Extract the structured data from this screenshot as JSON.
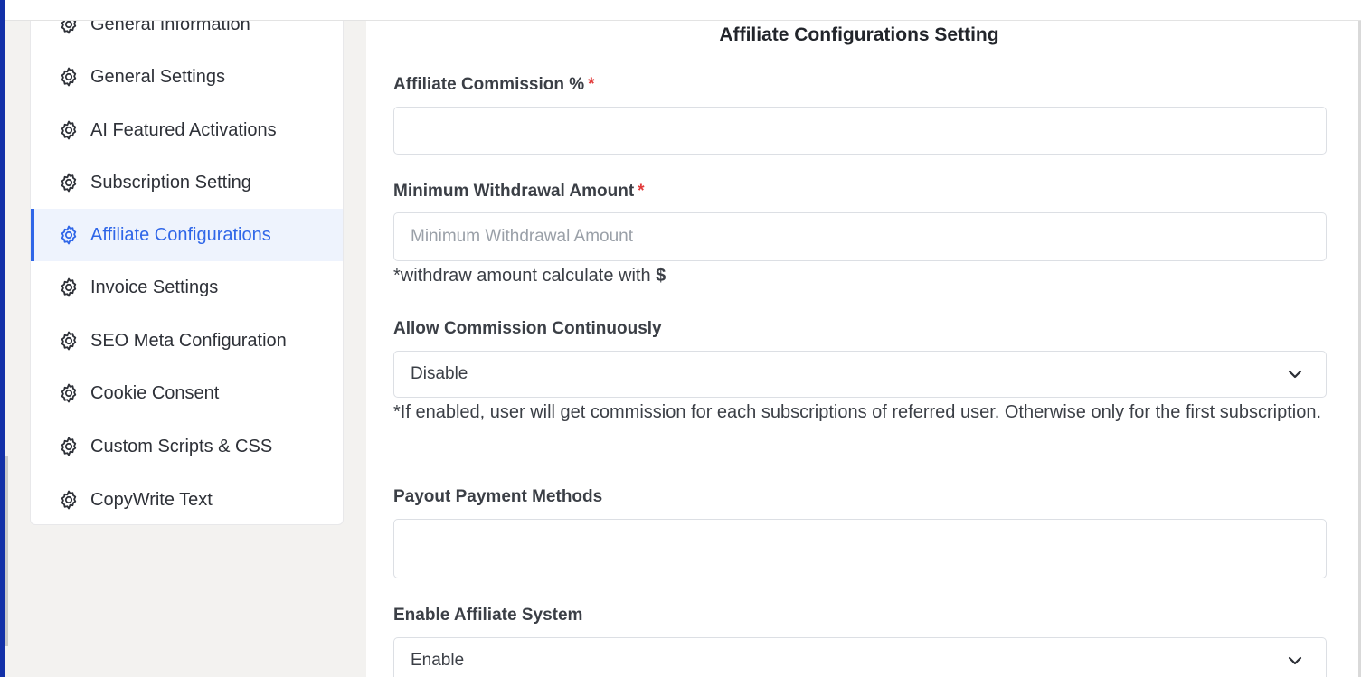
{
  "sidebar": {
    "items": [
      {
        "label": "General Information",
        "icon": "gear-icon",
        "active": false
      },
      {
        "label": "General Settings",
        "icon": "gear-icon",
        "active": false
      },
      {
        "label": "AI Featured Activations",
        "icon": "gear-icon",
        "active": false
      },
      {
        "label": "Subscription Setting",
        "icon": "gear-icon",
        "active": false
      },
      {
        "label": "Affiliate Configurations",
        "icon": "gear-icon",
        "active": true
      },
      {
        "label": "Invoice Settings",
        "icon": "gear-icon",
        "active": false
      },
      {
        "label": "SEO Meta Configuration",
        "icon": "gear-icon",
        "active": false
      },
      {
        "label": "Cookie Consent",
        "icon": "gear-icon",
        "active": false
      },
      {
        "label": "Custom Scripts & CSS",
        "icon": "gear-icon",
        "active": false
      },
      {
        "label": "CopyWrite Text",
        "icon": "gear-icon",
        "active": false
      }
    ]
  },
  "main": {
    "title": "Affiliate Configurations Setting",
    "commission": {
      "label": "Affiliate Commission %",
      "required": "*",
      "value": "",
      "placeholder": ""
    },
    "min_withdrawal": {
      "label": "Minimum Withdrawal Amount",
      "required": "*",
      "value": "",
      "placeholder": "Minimum Withdrawal Amount",
      "hint": "*withdraw amount calculate with",
      "hint_currency": "$"
    },
    "allow_continuous": {
      "label": "Allow Commission Continuously",
      "value": "Disable",
      "hint": "*If enabled, user will get commission for each subscriptions of referred user. Otherwise only for the first subscription."
    },
    "payout_methods": {
      "label": "Payout Payment Methods",
      "value": ""
    },
    "enable_affiliate": {
      "label": "Enable Affiliate System",
      "value": "Enable"
    }
  },
  "colors": {
    "accent": "#2f66e8",
    "active_bg": "#eef3fd",
    "required": "#e23b3b",
    "edge": "#1230a8"
  }
}
